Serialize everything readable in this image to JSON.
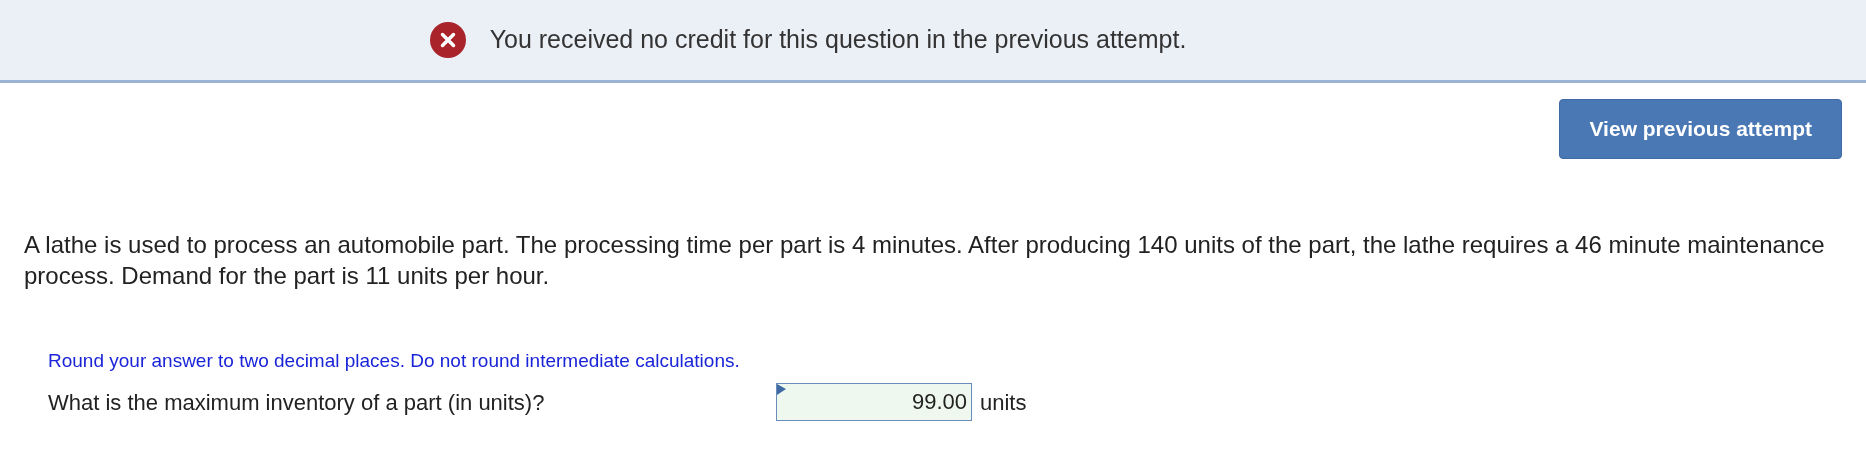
{
  "banner": {
    "kind": "error",
    "message": "You received no credit for this question in the previous attempt."
  },
  "view_button": {
    "label": "View previous attempt"
  },
  "question": {
    "text": "A lathe is used to process an automobile part. The processing time per part is 4 minutes. After producing 140 units of the part, the lathe requires a 46 minute maintenance process. Demand for the part is 11 units per hour."
  },
  "instruction": "Round your answer to two decimal places. Do not round intermediate calculations.",
  "answer": {
    "prompt": "What is the maximum inventory of a part (in units)?",
    "value": "99.00",
    "unit": "units"
  }
}
